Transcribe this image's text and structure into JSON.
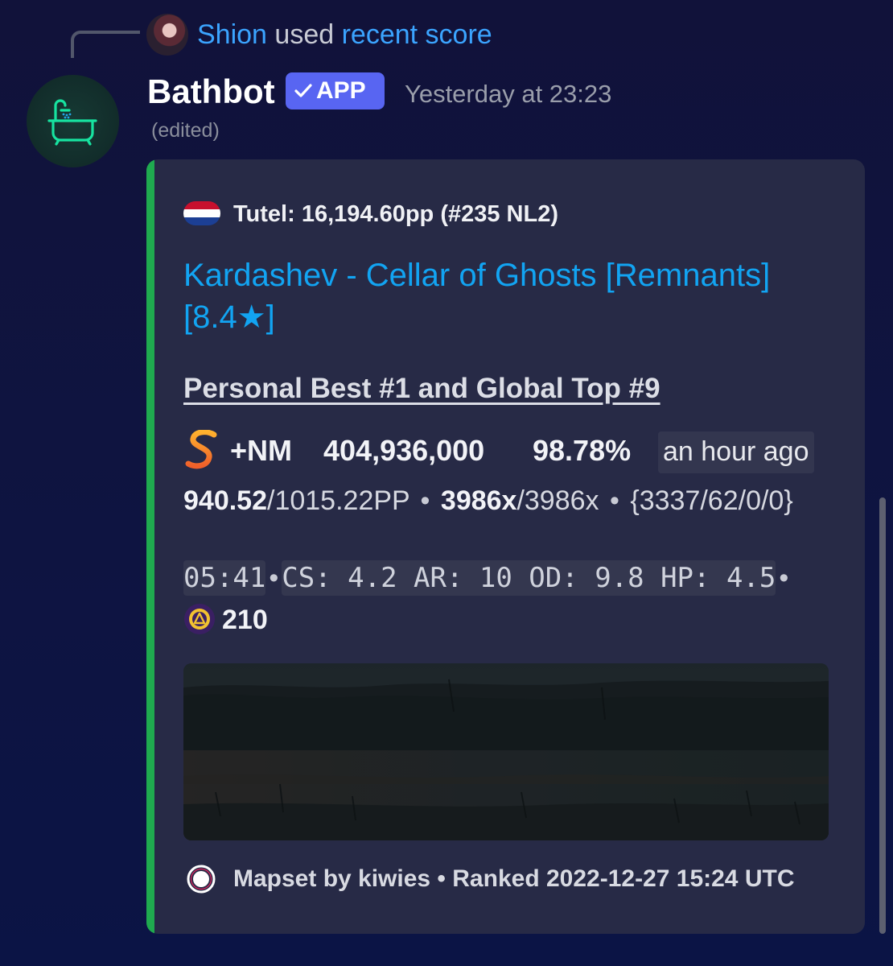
{
  "reply": {
    "user": "Shion",
    "used_text": "used",
    "command": "recent score"
  },
  "message": {
    "author": "Bathbot",
    "badge": "APP",
    "timestamp": "Yesterday at 23:23",
    "edited": "(edited)"
  },
  "embed": {
    "accent_color": "#1faa4f",
    "author": "Tutel: 16,194.60pp (#235 NL2)",
    "title": "Kardashev - Cellar of Ghosts [Remnants] [8.4★]",
    "subtitle": "Personal Best #1 and Global Top #9",
    "grade_icon": "grade-s-icon",
    "mods": "+NM",
    "score": "404,936,000",
    "accuracy": "98.78%",
    "time_ago": "an hour ago",
    "pp": "940.52",
    "max_pp": "/1015.22PP",
    "combo": "3986x",
    "max_combo": "/3986x",
    "hits": "{3337/62/0/0}",
    "length": "05:41",
    "attributes": "CS: 4.2 AR: 10 OD: 9.8 HP: 4.5",
    "playcount_icon": "playcount-icon",
    "playcount": "210",
    "footer": "Mapset by kiwies • Ranked 2022-12-27 15:24 UTC",
    "footer_icon": "osu-mode-icon"
  }
}
